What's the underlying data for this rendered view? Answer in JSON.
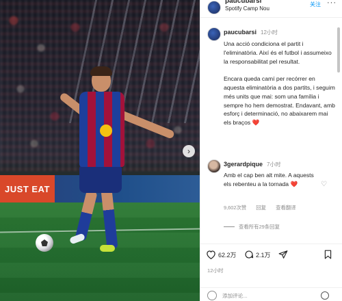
{
  "header": {
    "username": "paucubarsi",
    "location": "Spotify Camp Nou",
    "follow_label": "关注",
    "more_label": "···"
  },
  "photo": {
    "ad_text": "JUST EAT",
    "next_label": "›"
  },
  "caption": {
    "username": "paucubarsi",
    "time": "12小时",
    "text": "Una acció condiciona el partit i l'eliminatòria. Així és el futbol i assumeixo la responsabilitat pel resultat.\n\nEncara queda camí per recórrer en aquesta eliminatòria a dos partits, i seguim més units que mai: som una família i sempre ho hem demostrat. Endavant, amb esforç i determinació, no abaixarem mai els braços ❤️"
  },
  "comment": {
    "username": "3gerardpique",
    "time": "7小时",
    "text": "Amb el cap ben alt mite. A aquests els rebenteu a la tornada ❤️",
    "likes": "9,602次赞",
    "reply_label": "回复",
    "translate_label": "查看翻译",
    "view_replies": "查看所有29条回复"
  },
  "actions": {
    "likes": "62.2万",
    "comments": "2.1万"
  },
  "post_date": "12小时",
  "add_comment": {
    "placeholder": "添加评论..."
  },
  "colors": {
    "accent": "#0095f6",
    "muted": "#8e8e8e",
    "text": "#262626"
  }
}
